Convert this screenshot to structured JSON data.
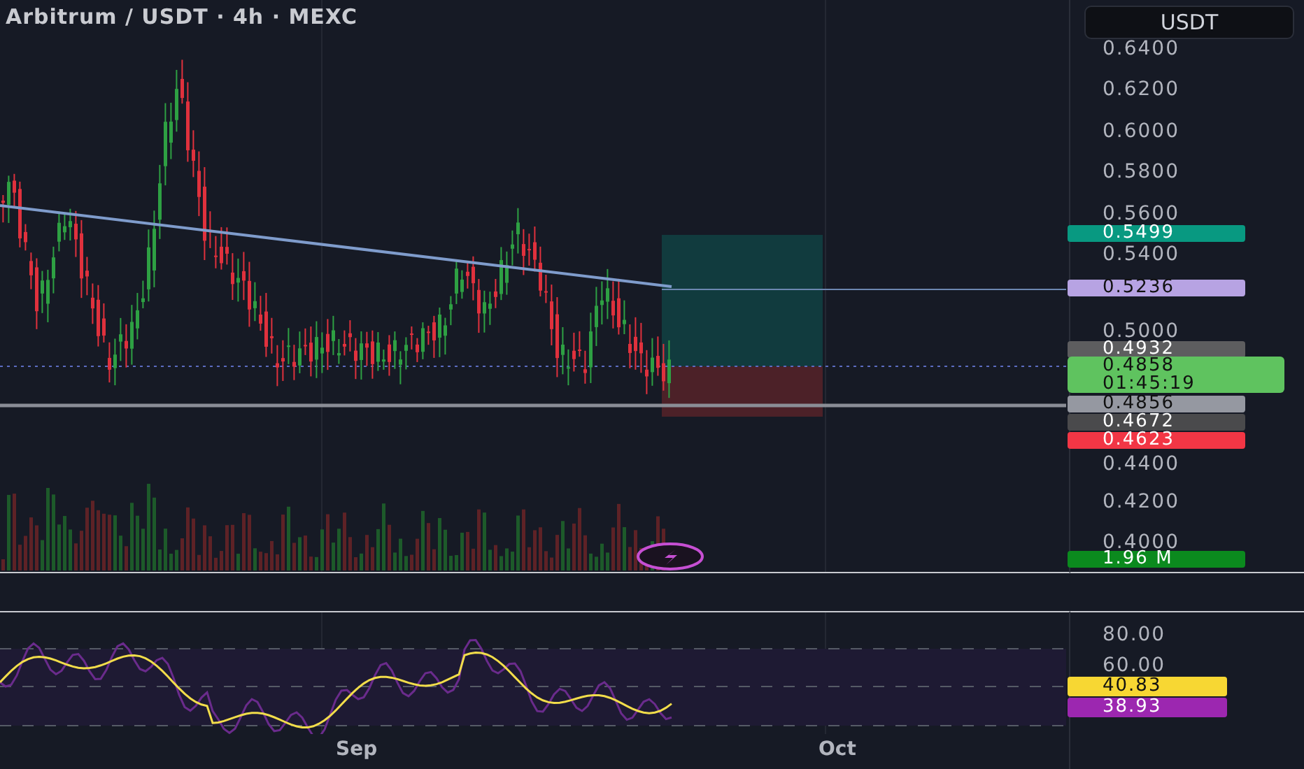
{
  "header": {
    "title": "Arbitrum / USDT · 4h · MEXC"
  },
  "price_axis": {
    "currency_button": "USDT",
    "ticks": [
      "0.6400",
      "0.6200",
      "0.6000",
      "0.5800",
      "0.5600",
      "0.5400",
      "0.5000",
      "0.4400",
      "0.4200",
      "0.4000"
    ],
    "tags": [
      {
        "text": "0.5499",
        "color": "#089981"
      },
      {
        "text": "0.5236",
        "color": "#b7a3e3"
      },
      {
        "text": "0.4932",
        "color": "#5d5d5f"
      },
      {
        "text": "0.4858",
        "subtext": "01:45:19",
        "color": "#5fc35f"
      },
      {
        "text": "0.4856",
        "color": "#9598a1"
      },
      {
        "text": "0.4672",
        "color": "#4a4a4c"
      },
      {
        "text": "0.4623",
        "color": "#f23645"
      },
      {
        "text": "1.96 M",
        "color": "#0b8a1e"
      }
    ]
  },
  "rsi_axis": {
    "ticks": [
      "80.00",
      "60.00"
    ],
    "tags": [
      {
        "text": "40.83",
        "color": "#f7d733"
      },
      {
        "text": "38.93",
        "color": "#9c27b0"
      }
    ]
  },
  "time_axis": {
    "labels": [
      "Sep",
      "Oct"
    ]
  }
}
